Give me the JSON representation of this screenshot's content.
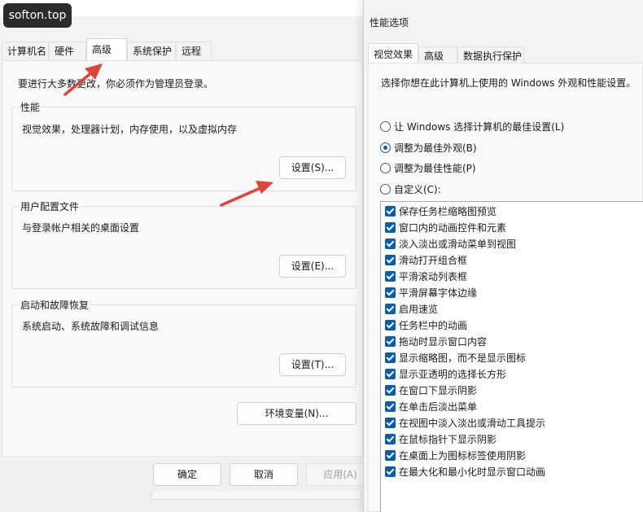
{
  "watermark": "softon.top",
  "left_dialog": {
    "tabs": [
      "计算机名",
      "硬件",
      "高级",
      "系统保护",
      "远程"
    ],
    "active_tab": "高级",
    "admin_note": "要进行大多数更改，你必须作为管理员登录。",
    "performance": {
      "title": "性能",
      "description": "视觉效果，处理器计划，内存使用，以及虚拟内存",
      "button": "设置(S)..."
    },
    "user_profiles": {
      "title": "用户配置文件",
      "description": "与登录帐户相关的桌面设置",
      "button": "设置(E)..."
    },
    "startup_recovery": {
      "title": "启动和故障恢复",
      "description": "系统启动、系统故障和调试信息",
      "button": "设置(T)..."
    },
    "env_button": "环境变量(N)...",
    "footer": {
      "ok": "确定",
      "cancel": "取消",
      "apply": "应用(A)"
    }
  },
  "right_dialog": {
    "title": "性能选项",
    "tabs": [
      "视觉效果",
      "高级",
      "数据执行保护"
    ],
    "active_tab": "视觉效果",
    "description": "选择你想在此计算机上使用的 Windows 外观和性能设置。",
    "radio_options": [
      {
        "label": "让 Windows 选择计算机的最佳设置(L)",
        "selected": false
      },
      {
        "label": "调整为最佳外观(B)",
        "selected": true
      },
      {
        "label": "调整为最佳性能(P)",
        "selected": false
      },
      {
        "label": "自定义(C):",
        "selected": false
      }
    ],
    "effects": [
      "保存任务栏缩略图预览",
      "窗口内的动画控件和元素",
      "淡入淡出或滑动菜单到视图",
      "滑动打开组合框",
      "平滑滚动列表框",
      "平滑屏幕字体边缘",
      "启用速览",
      "任务栏中的动画",
      "拖动时显示窗口内容",
      "显示缩略图，而不是显示图标",
      "显示亚透明的选择长方形",
      "在窗口下显示阴影",
      "在单击后淡出菜单",
      "在视图中淡入淡出或滑动工具提示",
      "在鼠标指针下显示阴影",
      "在桌面上为图标标签使用阴影",
      "在最大化和最小化时显示窗口动画"
    ],
    "effects_checked": true
  },
  "colors": {
    "accent": "#0b5cad",
    "arrow": "#e0433a",
    "watermark_bg": "#2b2b2b"
  }
}
